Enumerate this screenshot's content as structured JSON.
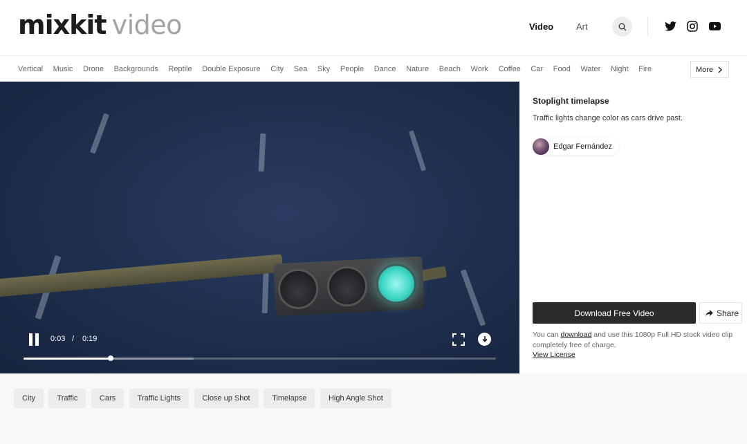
{
  "header": {
    "logo_brand": "mixkit",
    "logo_sub": "video",
    "nav": [
      {
        "label": "Video",
        "active": true
      },
      {
        "label": "Art",
        "active": false
      }
    ],
    "search_icon": "search-icon",
    "social_icons": [
      "twitter-icon",
      "instagram-icon",
      "youtube-icon"
    ]
  },
  "categories": {
    "items": [
      "Vertical",
      "Music",
      "Drone",
      "Backgrounds",
      "Reptile",
      "Double Exposure",
      "City",
      "Sea",
      "Sky",
      "People",
      "Dance",
      "Nature",
      "Beach",
      "Work",
      "Coffee",
      "Car",
      "Food",
      "Water",
      "Night",
      "Fire"
    ],
    "more_label": "More"
  },
  "player": {
    "current_time": "0:03",
    "separator": "/",
    "total_time": "0:19",
    "progress_fraction": 0.185,
    "buffered_fraction": 0.36
  },
  "details": {
    "title": "Stoplight timelapse",
    "description": "Traffic lights change color as cars drive past.",
    "author": "Edgar Fernández",
    "download_label": "Download Free Video",
    "share_label": "Share",
    "note_prefix": "You can ",
    "note_link": "download",
    "note_suffix": " and use this 1080p Full HD stock video clip completely free of charge.",
    "license_label": "View License"
  },
  "tags": [
    "City",
    "Traffic",
    "Cars",
    "Traffic Lights",
    "Close up Shot",
    "Timelapse",
    "High Angle Shot"
  ],
  "colors": {
    "download_button": "#2b2b2b",
    "video_background": "#1f2e4d",
    "traffic_light_green": "#3fd8c6"
  }
}
